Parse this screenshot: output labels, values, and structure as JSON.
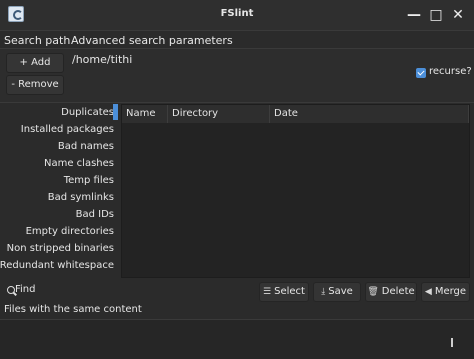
{
  "window": {
    "title": "FSlint",
    "controls": {
      "minimize": "—",
      "maximize": "□",
      "close": "✕"
    },
    "icon": "fslint-app-icon"
  },
  "tabs": [
    {
      "label": "Search path"
    },
    {
      "label": "Advanced search parameters"
    }
  ],
  "search_path": {
    "add_label": "+ Add",
    "remove_label": "- Remove",
    "paths": [
      "/home/tithi"
    ],
    "recurse_label": "recurse?",
    "recurse_checked": true
  },
  "sidebar": {
    "items": [
      {
        "label": "Duplicates"
      },
      {
        "label": "Installed packages"
      },
      {
        "label": "Bad names"
      },
      {
        "label": "Name clashes"
      },
      {
        "label": "Temp files"
      },
      {
        "label": "Bad symlinks"
      },
      {
        "label": "Bad IDs"
      },
      {
        "label": "Empty directories"
      },
      {
        "label": "Non stripped binaries"
      },
      {
        "label": "Redundant whitespace"
      }
    ]
  },
  "results": {
    "columns": [
      "Name",
      "Directory",
      "Date"
    ]
  },
  "actions": {
    "find_label": "Find",
    "select_label": "Select",
    "save_label": "Save",
    "delete_label": "Delete",
    "merge_label": "Merge"
  },
  "status": {
    "text": "Files with the same content"
  },
  "colors": {
    "accent": "#4c8fd9",
    "background": "#2b2b2b"
  }
}
